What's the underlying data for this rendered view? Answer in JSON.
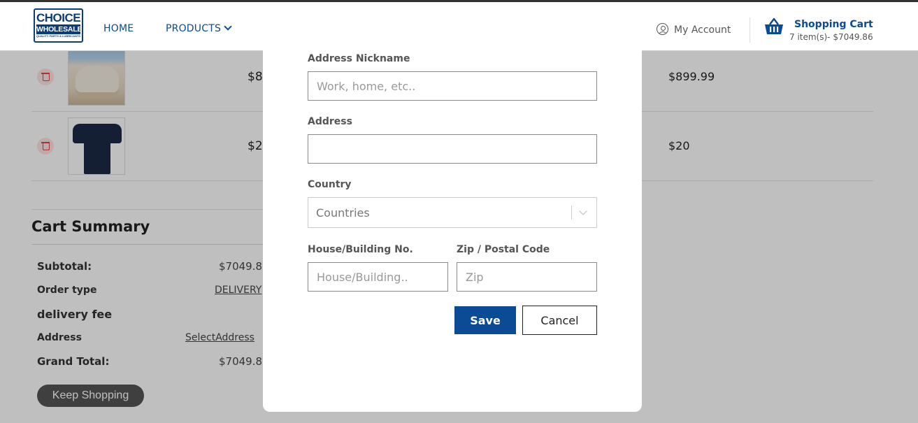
{
  "header": {
    "logo": {
      "line1": "CHOICE",
      "line2": "WHOLESALE",
      "tagline": "QUALITY PARTS & LUBRICANTS"
    },
    "nav": {
      "home": "HOME",
      "products": "PRODUCTS"
    },
    "account_label": "My Account",
    "cart": {
      "title": "Shopping Cart",
      "summary": "7 item(s)- $7049.86"
    }
  },
  "cart_items": [
    {
      "price": "$8",
      "total": "$899.99"
    },
    {
      "price": "$2",
      "total": "$20"
    }
  ],
  "summary": {
    "title": "Cart Summary",
    "subtotal_label": "Subtotal:",
    "subtotal_value": "$7049.8",
    "order_type_label": "Order type",
    "order_type_value": "DELIVERY",
    "delivery_fee_label": "delivery fee",
    "address_label": "Address",
    "address_value": "SelectAddress",
    "grand_total_label": "Grand Total:",
    "grand_total_value": "$7049.8",
    "keep_shopping": "Keep Shopping"
  },
  "modal": {
    "nickname_label": "Address Nickname",
    "nickname_placeholder": "Work, home, etc..",
    "address_label": "Address",
    "address_value": "",
    "country_label": "Country",
    "country_placeholder": "Countries",
    "house_label": "House/Building No.",
    "house_placeholder": "House/Building..",
    "zip_label": "Zip / Postal Code",
    "zip_placeholder": "Zip",
    "save_label": "Save",
    "cancel_label": "Cancel"
  },
  "colors": {
    "brand_blue": "#0b4a94",
    "logo_blue": "#0b3d7a",
    "overlay": "rgba(0,0,0,0.25)",
    "delete_red": "#dd4444"
  },
  "icons": {
    "account": "user-circle-icon",
    "cart": "basket-icon",
    "products_dropdown": "chevron-down-icon",
    "country_dropdown": "chevron-down-icon",
    "delete": "trash-icon"
  }
}
